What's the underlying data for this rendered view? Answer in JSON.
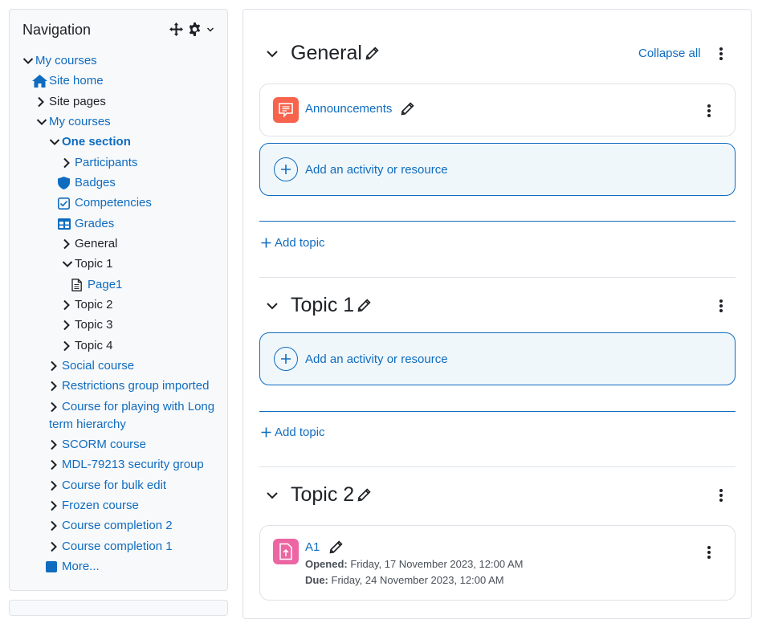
{
  "navigation": {
    "title": "Navigation",
    "items": [
      {
        "label": "My courses"
      },
      {
        "label": "Site home"
      },
      {
        "label": "Site pages"
      },
      {
        "label": "My courses"
      },
      {
        "label": "One section"
      },
      {
        "label": "Participants"
      },
      {
        "label": "Badges"
      },
      {
        "label": "Competencies"
      },
      {
        "label": "Grades"
      },
      {
        "label": "General"
      },
      {
        "label": "Topic 1"
      },
      {
        "label": "Page1"
      },
      {
        "label": "Topic 2"
      },
      {
        "label": "Topic 3"
      },
      {
        "label": "Topic 4"
      },
      {
        "label": "Social course"
      },
      {
        "label": "Restrictions group imported"
      },
      {
        "label": "Course for playing with Long term hierarchy"
      },
      {
        "label": "SCORM course"
      },
      {
        "label": "MDL-79213 security group"
      },
      {
        "label": "Course for bulk edit"
      },
      {
        "label": "Frozen course"
      },
      {
        "label": "Course completion 2"
      },
      {
        "label": "Course completion 1"
      },
      {
        "label": "More..."
      }
    ]
  },
  "main": {
    "collapse_all": "Collapse all",
    "add_activity_label": "Add an activity or resource",
    "add_topic_label": "Add topic",
    "sections": [
      {
        "title": "General",
        "activities": [
          {
            "name": "Announcements",
            "icon": "forum-icon",
            "color": "#f7634d"
          }
        ]
      },
      {
        "title": "Topic 1",
        "activities": []
      },
      {
        "title": "Topic 2",
        "activities": [
          {
            "name": "A1",
            "icon": "assignment-icon",
            "color": "#eb66a2",
            "opened_label": "Opened:",
            "opened_value": "Friday, 17 November 2023, 12:00 AM",
            "due_label": "Due:",
            "due_value": "Friday, 24 November 2023, 12:00 AM"
          }
        ]
      }
    ]
  },
  "colors": {
    "link": "#0f6cbf",
    "text": "#1d2125",
    "border": "#dee2e6",
    "forum": "#f7634d",
    "assign": "#eb66a2"
  }
}
